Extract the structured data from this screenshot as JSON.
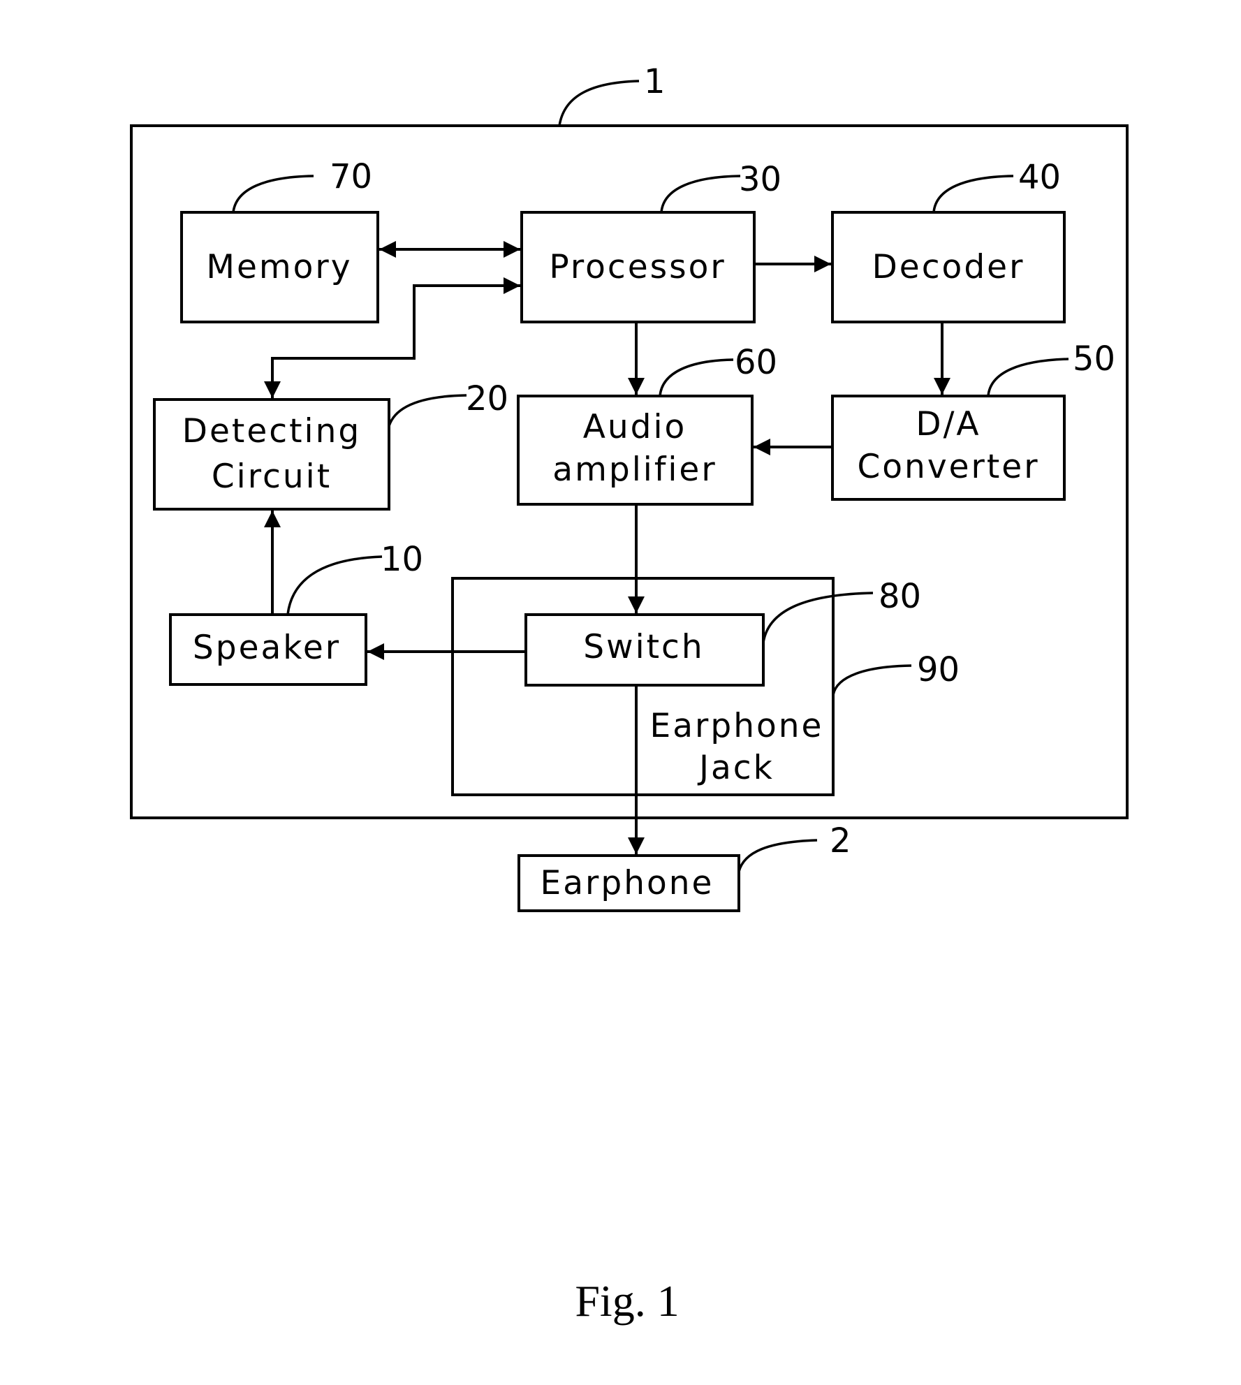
{
  "figure": {
    "caption": "Fig. 1",
    "device": {
      "ref": "1"
    },
    "blocks": {
      "memory": {
        "ref": "70",
        "lines": [
          "Memory"
        ]
      },
      "processor": {
        "ref": "30",
        "lines": [
          "Processor"
        ]
      },
      "decoder": {
        "ref": "40",
        "lines": [
          "Decoder"
        ]
      },
      "detecting_circuit": {
        "ref": "20",
        "lines": [
          "Detecting",
          "Circuit"
        ]
      },
      "audio_amplifier": {
        "ref": "60",
        "lines": [
          "Audio",
          "amplifier"
        ]
      },
      "da_converter": {
        "ref": "50",
        "lines": [
          "D/A",
          "Converter"
        ]
      },
      "speaker": {
        "ref": "10",
        "lines": [
          "Speaker"
        ]
      },
      "switch": {
        "ref": "80",
        "lines": [
          "Switch"
        ]
      },
      "earphone_jack": {
        "ref": "90",
        "lines": [
          "Earphone",
          "Jack"
        ]
      },
      "earphone": {
        "ref": "2",
        "lines": [
          "Earphone"
        ]
      }
    },
    "connections": [
      {
        "from": "memory",
        "to": "processor",
        "direction": "bidirectional"
      },
      {
        "from": "detecting_circuit",
        "to": "processor",
        "direction": "bidirectional"
      },
      {
        "from": "processor",
        "to": "decoder",
        "direction": "forward"
      },
      {
        "from": "processor",
        "to": "audio_amplifier",
        "direction": "forward"
      },
      {
        "from": "decoder",
        "to": "da_converter",
        "direction": "forward"
      },
      {
        "from": "da_converter",
        "to": "audio_amplifier",
        "direction": "forward"
      },
      {
        "from": "audio_amplifier",
        "to": "switch",
        "direction": "forward"
      },
      {
        "from": "switch",
        "to": "speaker",
        "direction": "forward"
      },
      {
        "from": "speaker",
        "to": "detecting_circuit",
        "direction": "forward"
      },
      {
        "from": "switch",
        "to": "earphone",
        "direction": "forward"
      }
    ]
  }
}
